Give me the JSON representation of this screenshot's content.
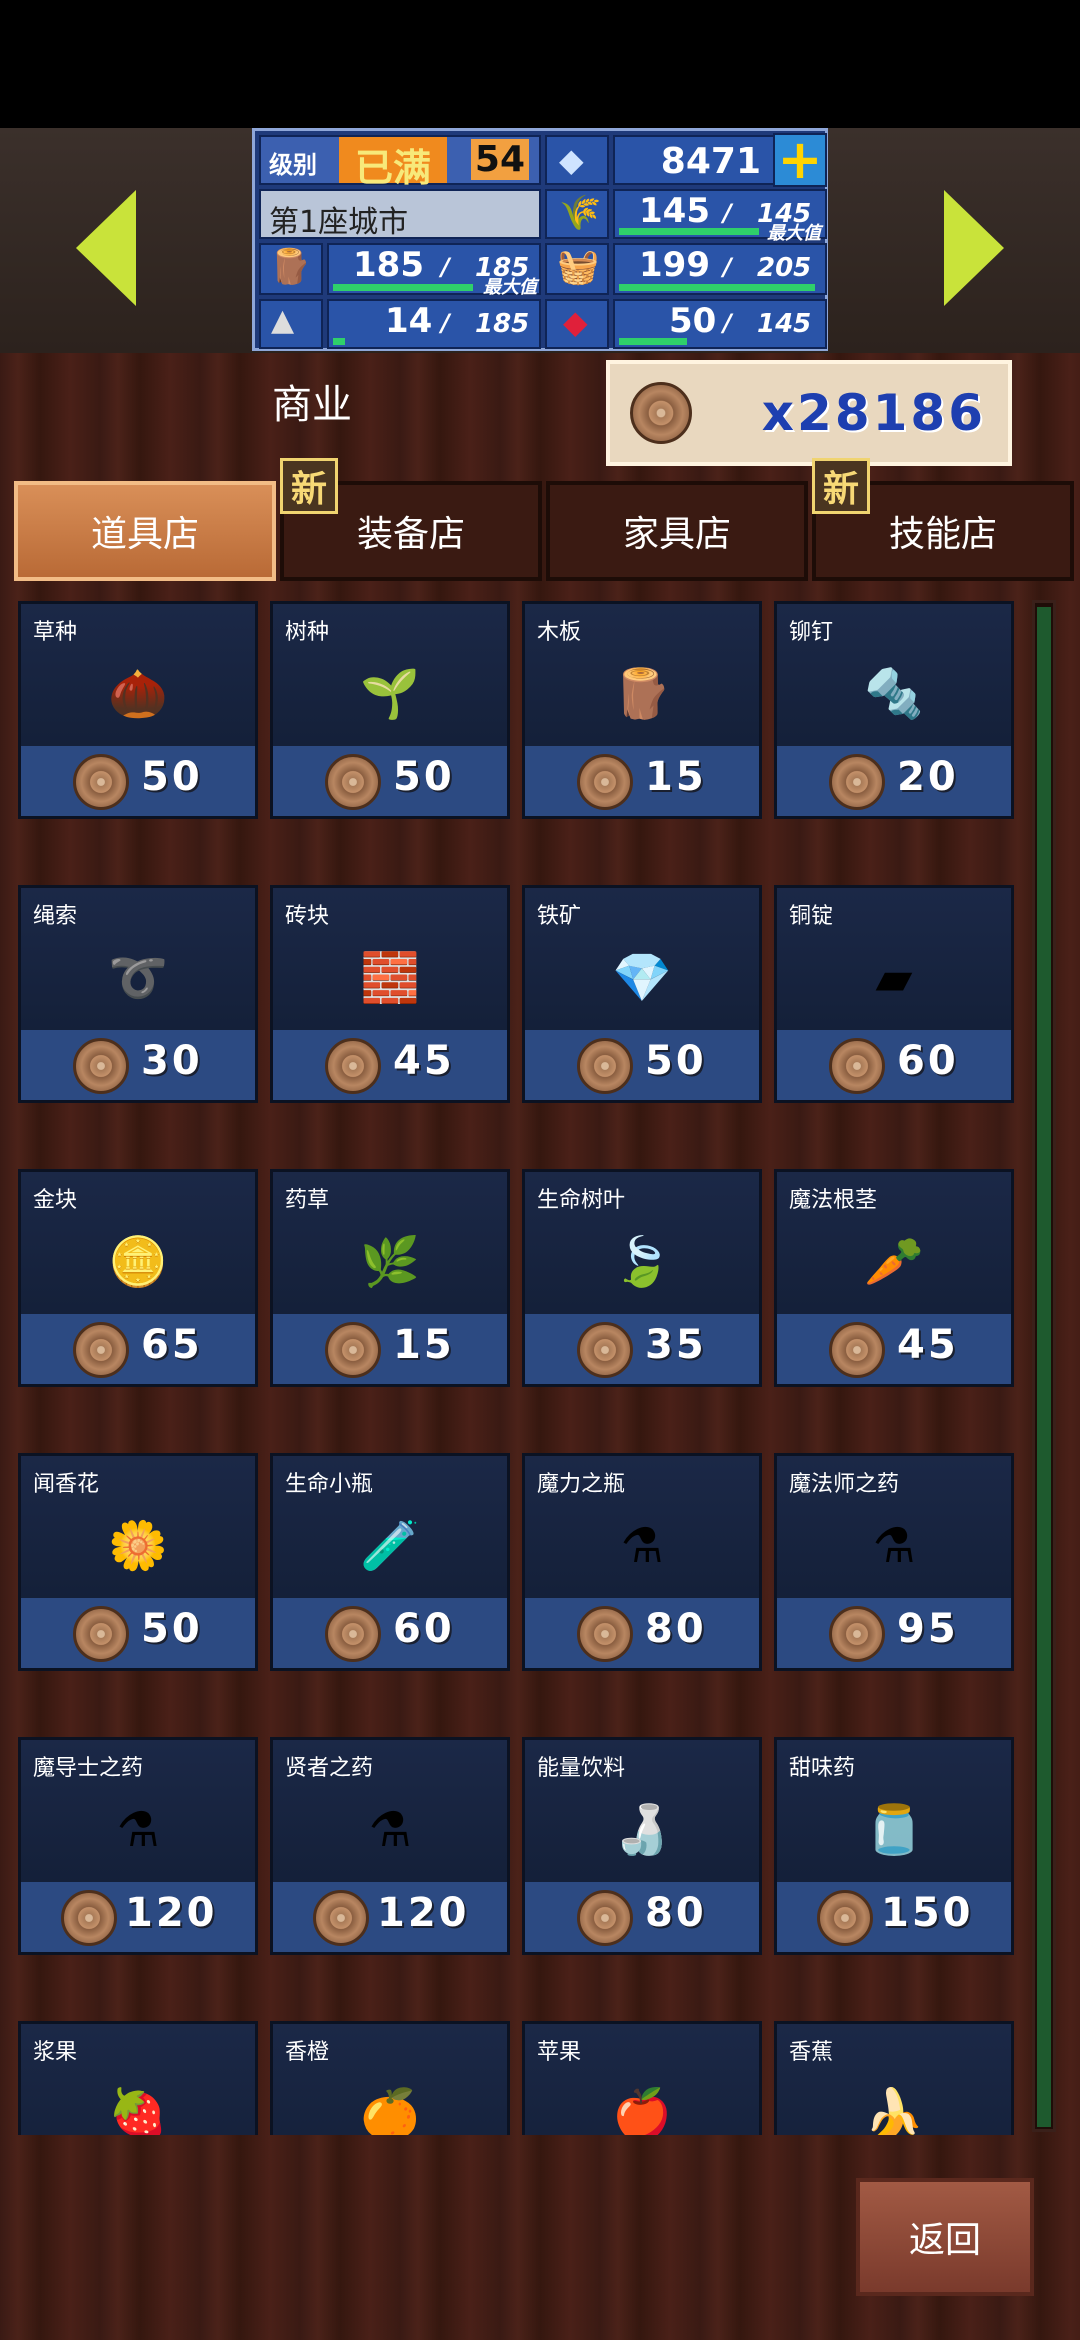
{
  "hud": {
    "level_label": "级别",
    "level_status": "已满",
    "level_value": "54",
    "diamonds": "8471",
    "plus": "+",
    "city_name": "第1座城市",
    "stat_grain": {
      "value": "145",
      "max": "145",
      "note": "最大值"
    },
    "stat_wood": {
      "value": "185",
      "max": "185",
      "note": "最大值"
    },
    "stat_food": {
      "value": "199",
      "max": "205"
    },
    "stat_stone": {
      "value": "14",
      "max": "185"
    },
    "stat_gem": {
      "value": "50",
      "max": "145"
    },
    "slash": "/"
  },
  "page": {
    "title": "商业",
    "currency_value": "x28186"
  },
  "tabs": [
    {
      "label": "道具店",
      "active": true,
      "new": false
    },
    {
      "label": "装备店",
      "active": false,
      "new": true
    },
    {
      "label": "家具店",
      "active": false,
      "new": false
    },
    {
      "label": "技能店",
      "active": false,
      "new": true
    }
  ],
  "new_badge": "新",
  "items": [
    {
      "name": "草种",
      "price": "50",
      "icon": "🌰"
    },
    {
      "name": "树种",
      "price": "50",
      "icon": "🌱"
    },
    {
      "name": "木板",
      "price": "15",
      "icon": "🪵"
    },
    {
      "name": "铆钉",
      "price": "20",
      "icon": "🔩"
    },
    {
      "name": "绳索",
      "price": "30",
      "icon": "➰"
    },
    {
      "name": "砖块",
      "price": "45",
      "icon": "🧱"
    },
    {
      "name": "铁矿",
      "price": "50",
      "icon": "💎"
    },
    {
      "name": "铜锭",
      "price": "60",
      "icon": "▰"
    },
    {
      "name": "金块",
      "price": "65",
      "icon": "🪙"
    },
    {
      "name": "药草",
      "price": "15",
      "icon": "🌿"
    },
    {
      "name": "生命树叶",
      "price": "35",
      "icon": "🍃"
    },
    {
      "name": "魔法根茎",
      "price": "45",
      "icon": "🥕"
    },
    {
      "name": "闻香花",
      "price": "50",
      "icon": "🌼"
    },
    {
      "name": "生命小瓶",
      "price": "60",
      "icon": "🧪"
    },
    {
      "name": "魔力之瓶",
      "price": "80",
      "icon": "⚗"
    },
    {
      "name": "魔法师之药",
      "price": "95",
      "icon": "⚗"
    },
    {
      "name": "魔导士之药",
      "price": "120",
      "icon": "⚗"
    },
    {
      "name": "贤者之药",
      "price": "120",
      "icon": "⚗"
    },
    {
      "name": "能量饮料",
      "price": "80",
      "icon": "🍶"
    },
    {
      "name": "甜味药",
      "price": "150",
      "icon": "🫙"
    },
    {
      "name": "浆果",
      "price": "",
      "icon": "🍓"
    },
    {
      "name": "香橙",
      "price": "",
      "icon": "🍊"
    },
    {
      "name": "苹果",
      "price": "",
      "icon": "🍎"
    },
    {
      "name": "香蕉",
      "price": "",
      "icon": "🍌"
    }
  ],
  "back_label": "返回",
  "colors": {
    "accent": "#c9e33a",
    "hud_blue": "#2a54a8",
    "tab_active": "#d98f58",
    "bar_green": "#2fd06a"
  }
}
